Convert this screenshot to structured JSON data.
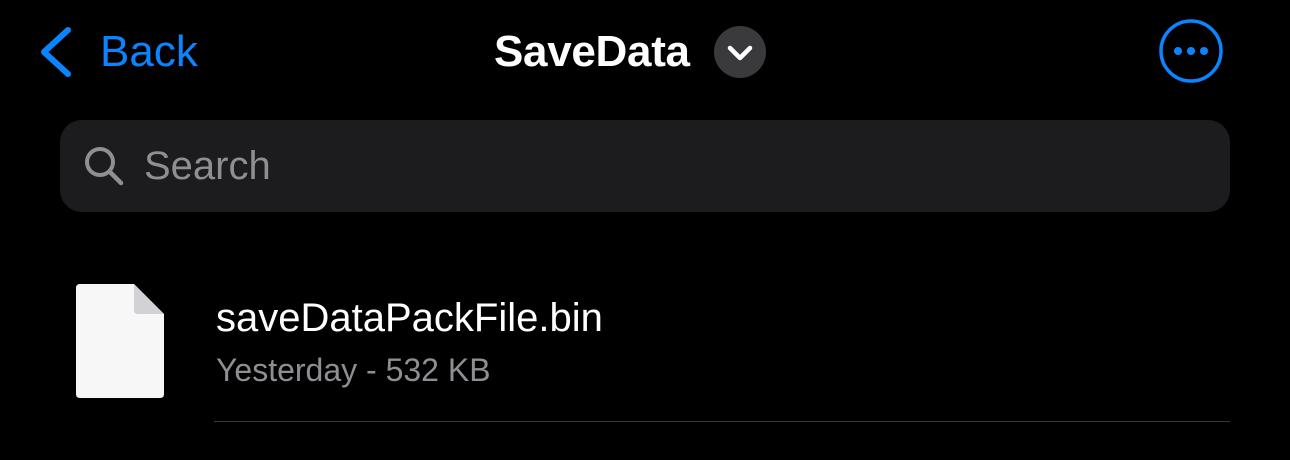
{
  "nav": {
    "back_label": "Back",
    "back_icon": "chevron-left-icon",
    "title": "SaveData",
    "title_menu_icon": "chevron-down-icon",
    "more_icon": "ellipsis-circle-icon"
  },
  "search": {
    "placeholder": "Search",
    "value": "",
    "icon": "magnifying-glass-icon"
  },
  "files": [
    {
      "name": "saveDataPackFile.bin",
      "meta": "Yesterday - 532 KB",
      "icon": "document-icon"
    }
  ],
  "colors": {
    "background": "#000000",
    "accent": "#0a84ff",
    "primary_text": "#ffffff",
    "secondary_text": "#8e8e93",
    "search_background": "#1c1c1e",
    "chevron_button_background": "#3a3a3c",
    "separator": "#38383a",
    "file_icon_fill": "#f7f7f7"
  }
}
